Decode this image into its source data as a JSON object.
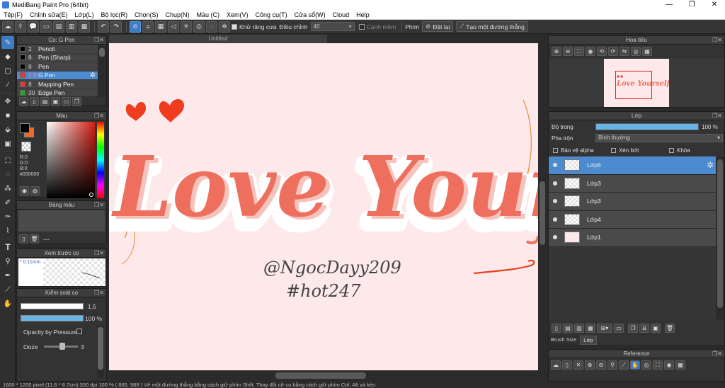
{
  "window": {
    "title": "MediBang Paint Pro (64bit)",
    "minimize": "—",
    "maximize": "❐",
    "close": "✕"
  },
  "menu": [
    "Tệp(F)",
    "Chỉnh sửa(E)",
    "Lớp(L)",
    "Bộ lọc(R)",
    "Chọn(S)",
    "Chụp(N)",
    "Màu (C)",
    "Xem(V)",
    "Công cụ(T)",
    "Cửa sổ(W)",
    "Cloud",
    "Help"
  ],
  "toolbar": {
    "antialias_label": "Khử răng cưa",
    "adjust_label": "Điều chỉnh",
    "adjust_value": "40",
    "edge_label": "Cạnh mềm",
    "keys_label": "Phím",
    "reset_label": "Đặt lại",
    "make_line_label": "Tạo một đường thẳng"
  },
  "brush_panel": {
    "title": "Cọ: G Pen",
    "items": [
      {
        "size": "2",
        "name": "Pencil"
      },
      {
        "size": "8",
        "name": "Pen (Sharp)"
      },
      {
        "size": "8",
        "name": "Pen"
      },
      {
        "size": "1.5",
        "name": "G Pen"
      },
      {
        "size": "8",
        "name": "Mapping Pen"
      },
      {
        "size": "30",
        "name": "Edge Pen"
      }
    ]
  },
  "color_panel": {
    "title": "Màu",
    "r": "R:0",
    "g": "G:0",
    "b": "B:0",
    "hex": "#000000"
  },
  "palette_panel": {
    "title": "Bảng màu",
    "dashes": "---"
  },
  "brush_preview_panel": {
    "title": "Xem trước cọ",
    "size_label": "0.11mm"
  },
  "brush_control_panel": {
    "title": "Kiểm soát cọ",
    "size_value": "1.5",
    "opacity_value": "100 %",
    "opacity_pressure_label": "Opacity by Pressure",
    "ooze_label": "Ooze",
    "ooze_value": "3"
  },
  "document": {
    "tab_title": "Untitled",
    "text_main": "Love Yourself",
    "text_signature": "@NgocDayy209",
    "text_hashtag": "#hot247"
  },
  "navigator_panel": {
    "title": "Hoa tiêu"
  },
  "layer_panel": {
    "title": "Lớp",
    "opacity_label": "Độ trong",
    "opacity_value": "100 %",
    "opacity_fraction": 1.0,
    "blend_label": "Pha trộn",
    "blend_value": "Bình thường",
    "protect_alpha": "Bảo vệ alpha",
    "clipping": "Xén bớt",
    "lock": "Khóa",
    "layers": [
      {
        "name": "Lớp6",
        "selected": true
      },
      {
        "name": "Lớp3",
        "selected": false
      },
      {
        "name": "Lớp3",
        "selected": false
      },
      {
        "name": "Lớp4",
        "selected": false
      },
      {
        "name": "Lớp1",
        "selected": false
      }
    ],
    "tab_brush_size": "Brush Size",
    "tab_layer": "Lớp"
  },
  "reference_panel": {
    "title": "Reference"
  },
  "status": {
    "text": "1600 * 1200 pixel   (11.6 * 8.7cm)   350 dpi   100 %   ( 865, 989 )   Vẽ một đường thẳng bằng cách giữ phím Shift, Thay đổi cỡ cọ bằng cách giữ phím Ctrl, Alt và kéo"
  },
  "colors": {
    "accent": "#4c8bcf",
    "lettering": "#ee6f5e",
    "canvas_bg": "#fde9ea",
    "heart": "#f03c1e"
  }
}
